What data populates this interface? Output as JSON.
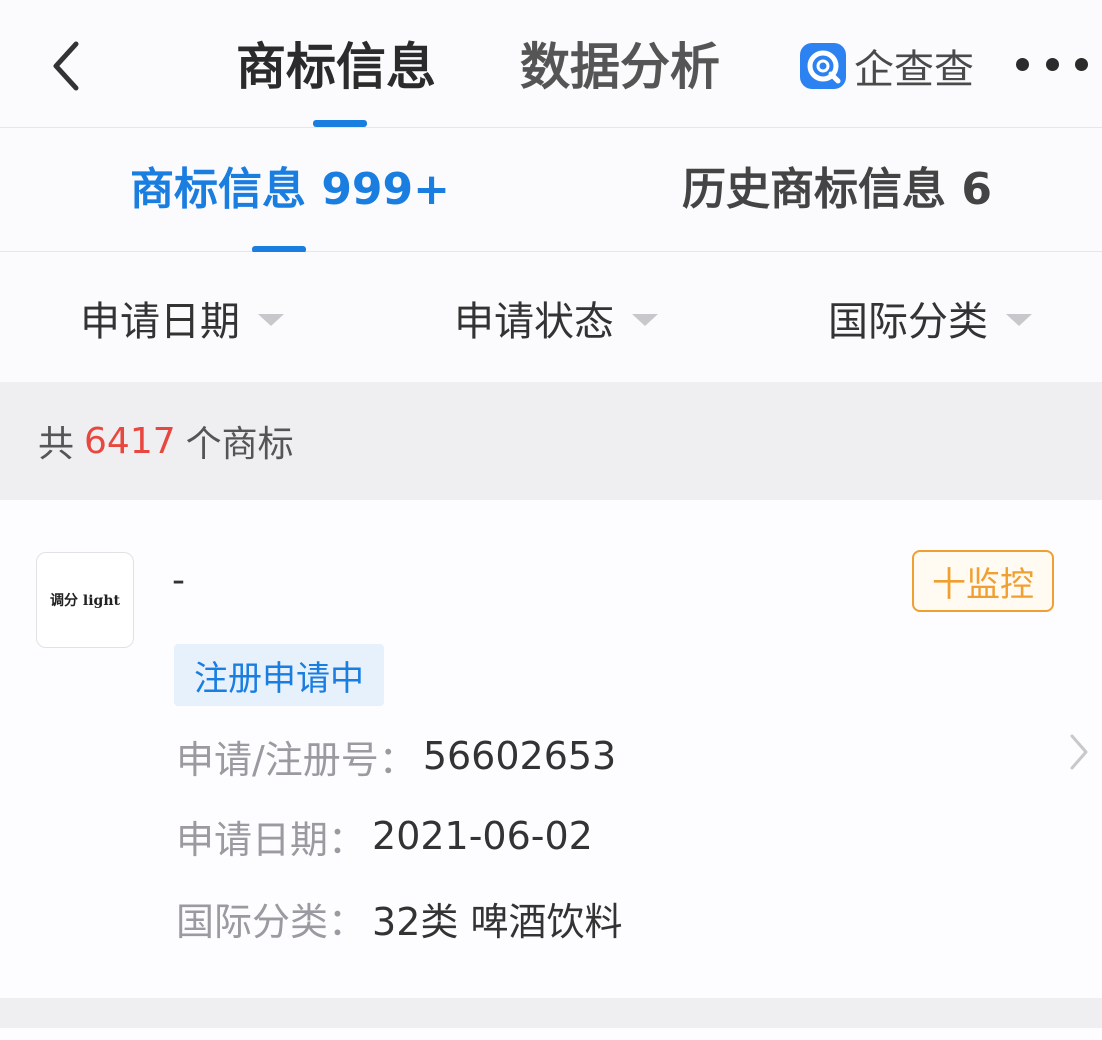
{
  "header": {
    "tabs": [
      {
        "label": "商标信息",
        "active": true
      },
      {
        "label": "数据分析",
        "active": false
      }
    ],
    "brand_name": "企查查"
  },
  "subtabs": [
    {
      "label": "商标信息 999+",
      "active": true
    },
    {
      "label": "历史商标信息 6",
      "active": false
    }
  ],
  "filters": [
    {
      "label": "申请日期"
    },
    {
      "label": "申请状态"
    },
    {
      "label": "国际分类"
    }
  ],
  "count": {
    "prefix": "共",
    "number": "6417",
    "suffix": "个商标"
  },
  "card": {
    "logo_text": "调分 light",
    "name": "-",
    "monitor_label": "十监控",
    "status": "注册申请中",
    "rows": [
      {
        "key": "申请/注册号：",
        "value": "56602653"
      },
      {
        "key": "申请日期：",
        "value": "2021-06-02"
      },
      {
        "key": "国际分类：",
        "value": "32类 啤酒饮料"
      }
    ]
  },
  "colors": {
    "accent": "#1a7de0",
    "count_highlight": "#e8473f",
    "monitor": "#f0a030"
  },
  "icons": [
    "back-arrow-icon",
    "brand-logo-icon",
    "more-icon",
    "dropdown-caret-icon",
    "chevron-right-icon"
  ]
}
